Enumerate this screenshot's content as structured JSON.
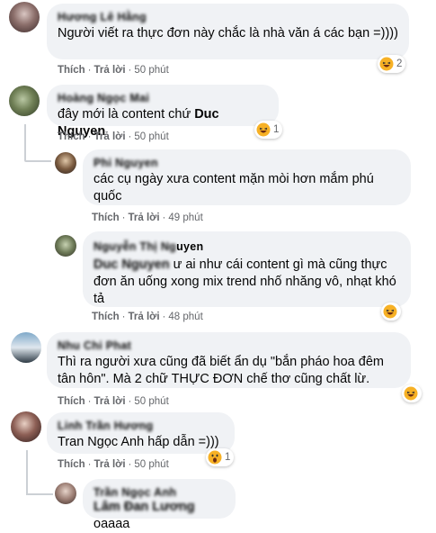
{
  "comments": [
    {
      "author": "Hương Lê Hằng",
      "text": "Người viết ra thực đơn này chắc là nhà văn á các bạn =))))",
      "like": "Thích",
      "reply": "Trả lời",
      "time": "50 phút",
      "reaction": {
        "icon": "haha-emoji-icon",
        "count": "2"
      }
    },
    {
      "author": "Hoàng Ngọc Mai",
      "prefix": "đây mới là content chứ ",
      "mention": "Duc Nguyen",
      "like": "Thích",
      "reply": "Trả lời",
      "time": "50 phút",
      "reaction": {
        "icon": "haha-emoji-icon",
        "count": "1"
      }
    },
    {
      "author": "Phi Nguyen",
      "text": "các cụ ngày xưa content mặn mòi hơn mắm phú quốc",
      "like": "Thích",
      "reply": "Trả lời",
      "time": "49 phút"
    },
    {
      "author_blur": "Nguyễn Thị Ng",
      "author_clear": "uyen",
      "mention_blur": "Duc Nguyen",
      "text": " ư ai như cái content gì mà cũng thực đơn ăn uống xong mix trend nhố nhăng vô, nhạt khó tả",
      "like": "Thích",
      "reply": "Trả lời",
      "time": "48 phút",
      "reaction": {
        "icon": "haha-emoji-icon"
      }
    },
    {
      "author": "Nhu Chi Phat",
      "text": "Thì ra người xưa cũng đã biết ẩn dụ \"bắn pháo hoa đêm tân hôn\". Mà 2 chữ THỰC ĐƠN chế thơ cũng chất lừ.",
      "like": "Thích",
      "reply": "Trả lời",
      "time": "50 phút",
      "reaction": {
        "icon": "haha-emoji-icon"
      }
    },
    {
      "author": "Linh Trần Hương",
      "mention": "Tran Ngọc Anh",
      "suffix": " hấp dẫn =)))",
      "like": "Thích",
      "reply": "Trả lời",
      "time": "50 phút",
      "reaction": {
        "icon": "wow-emoji-icon",
        "count": "1"
      }
    },
    {
      "author": "Trần Ngọc Anh",
      "mention_blur": "Lâm Đan Lương",
      "text": " oaaaa"
    }
  ],
  "colors": {
    "bubble": "#f0f2f5",
    "meta": "#65676b",
    "haha": "#f7b125",
    "text": "#050505"
  }
}
